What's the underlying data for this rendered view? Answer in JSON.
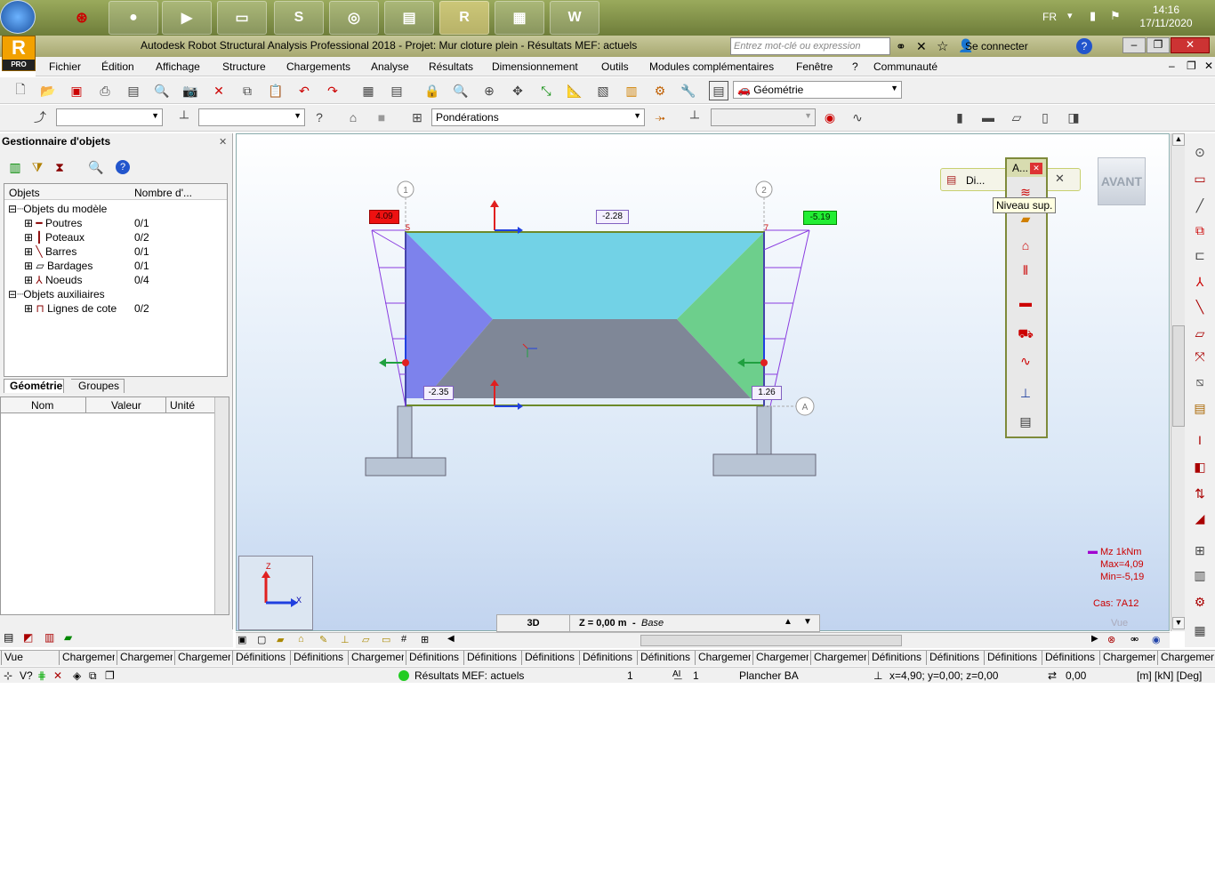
{
  "taskbar": {
    "lang": "FR",
    "time": "14:16",
    "date": "17/11/2020",
    "apps": [
      "chrome-icon",
      "media-player-icon",
      "explorer-icon",
      "skype-icon",
      "disc-icon",
      "winrar-icon",
      "revit-icon",
      "calculator-icon",
      "word-icon"
    ]
  },
  "window": {
    "title": "Autodesk Robot Structural Analysis Professional 2018 - Projet: Mur cloture plein - Résultats MEF: actuels",
    "logo": "R",
    "logo_sub": "PRO",
    "search_placeholder": "Entrez mot-clé ou expression",
    "signin": "Se connecter"
  },
  "menu": [
    "Fichier",
    "Édition",
    "Affichage",
    "Structure",
    "Chargements",
    "Analyse",
    "Résultats",
    "Dimensionnement",
    "Outils",
    "Modules complémentaires",
    "Fenêtre",
    "?",
    "Communauté"
  ],
  "toolbar": {
    "layout_combo": "Géométrie",
    "ponderations_combo": "Pondérations"
  },
  "object_manager": {
    "title": "Gestionnaire d'objets",
    "col_objects": "Objets",
    "col_count": "Nombre d'...",
    "model_group": "Objets du modèle",
    "items": [
      {
        "label": "Poutres",
        "count": "0/1"
      },
      {
        "label": "Poteaux",
        "count": "0/2"
      },
      {
        "label": "Barres",
        "count": "0/1"
      },
      {
        "label": "Bardages",
        "count": "0/1"
      },
      {
        "label": "Noeuds",
        "count": "0/4"
      }
    ],
    "aux_group": "Objets auxiliaires",
    "aux_items": [
      {
        "label": "Lignes de cote",
        "count": "0/2"
      }
    ],
    "tabs": [
      "Géométrie",
      "Groupes"
    ],
    "props_headers": [
      "Nom",
      "Valeur",
      "Unité"
    ]
  },
  "viewport": {
    "avant_btn": "AVANT",
    "axes": {
      "z": "Z",
      "x": "X"
    },
    "grid_labels": [
      "1",
      "2",
      "A"
    ],
    "node_labels": [
      "5",
      "7"
    ],
    "values": {
      "top_left": "4.09",
      "top_mid": "-2.28",
      "top_right": "-5.19",
      "bottom_left": "-2.35",
      "bottom_right": "1.26"
    },
    "legend": {
      "title": "Mz  1kNm",
      "max": "Max=4,09",
      "min": "Min=-5,19",
      "case": "Cas: 7A12",
      "vue": "Vue"
    },
    "level_bar": {
      "mode": "3D",
      "z": "Z = 0,00 m",
      "base": "Base"
    },
    "float_title": "A...",
    "float_tab": "Di...",
    "tooltip": "Niveau sup."
  },
  "view_tabs": [
    "Vue",
    "Chargement",
    "Chargement",
    "Chargement",
    "Définitions d",
    "Définitions d",
    "Chargement",
    "Définitions d",
    "Définitions d",
    "Définitions d",
    "Définitions d",
    "Définitions d",
    "Chargement",
    "Chargement",
    "Chargement",
    "Définitions d",
    "Définitions d",
    "Définitions d",
    "Définitions d",
    "Chargement",
    "Chargement"
  ],
  "status": {
    "results": "Résultats MEF: actuels",
    "num1": "1",
    "num2": "1",
    "section": "Plancher BA",
    "coords": "x=4,90; y=0,00; z=0,00",
    "angle": "0,00",
    "units": "[m] [kN] [Deg]"
  },
  "colors": {
    "accent": "#7e8a3a",
    "positive": "#ff0000",
    "negative": "#00cc00",
    "panel": "#f0f0f0"
  }
}
